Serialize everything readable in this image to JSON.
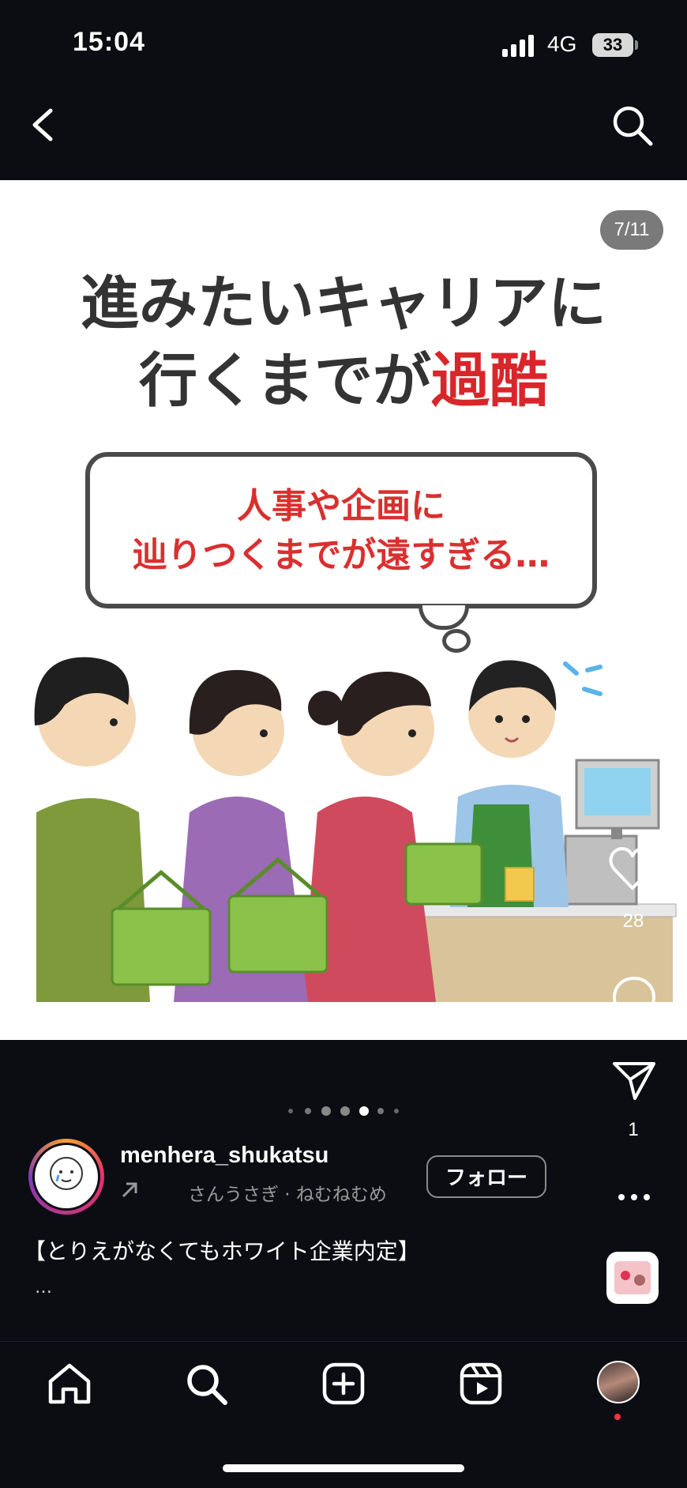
{
  "status_bar": {
    "time": "15:04",
    "network": "4G",
    "battery": "33"
  },
  "nav": {
    "back_icon": "chevron-left-icon",
    "search_icon": "search-icon"
  },
  "post": {
    "page_counter": "7/11",
    "headline_line1": "進みたいキャリアに",
    "headline_line2_dark": "行くまでが",
    "headline_line2_red": "過酷",
    "bubble_line1": "人事や企画に",
    "bubble_line2": "辿りつくまでが遠すぎる…",
    "accent_red": "#d9262b"
  },
  "actions": {
    "like_count": "28",
    "share_count": "1"
  },
  "carousel": {
    "total_dots": 7,
    "active_index": 4
  },
  "author": {
    "username": "menhera_shukatsu",
    "subline": "さんうさぎ · ねむねむめ",
    "follow_label": "フォロー"
  },
  "caption": {
    "text": "【とりえがなくてもホワイト企業内定】",
    "more": "…"
  }
}
